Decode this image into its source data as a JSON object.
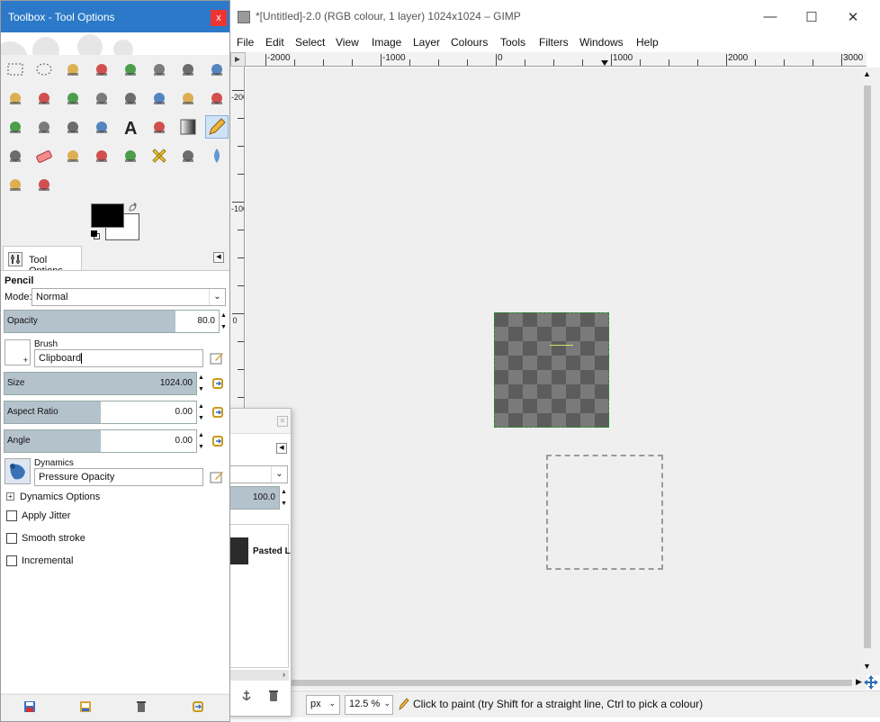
{
  "gimp": {
    "title": "*[Untitled]-2.0 (RGB colour, 1 layer) 1024x1024 – GIMP",
    "menu": [
      "File",
      "Edit",
      "Select",
      "View",
      "Image",
      "Layer",
      "Colours",
      "Tools",
      "Filters",
      "Windows",
      "Help"
    ],
    "ruler_h_labels": [
      "-2000",
      "-1000",
      "0",
      "1000",
      "2000",
      "3000"
    ],
    "ruler_v_labels": [
      "-200",
      "-100",
      "0"
    ],
    "status": {
      "coords": "…",
      "unit": "px",
      "zoom": "12.5 %",
      "message": "Click to paint (try Shift for a straight line, Ctrl to pick a colour)"
    }
  },
  "dock2": {
    "value": "100.0",
    "layer_name": "Pasted L"
  },
  "toolbox": {
    "title": "Toolbox - Tool Options",
    "close": "x",
    "tab_label": "Tool Options",
    "tool_name": "Pencil",
    "mode_label": "Mode:",
    "mode_value": "Normal",
    "opacity": {
      "label": "Opacity",
      "value": "80.0",
      "fraction": 0.8
    },
    "brush_label": "Brush",
    "brush_value": "Clipboard",
    "size": {
      "label": "Size",
      "value": "1024.00",
      "fraction": 1.0
    },
    "aspect_ratio": {
      "label": "Aspect Ratio",
      "value": "0.00",
      "fraction": 0.5
    },
    "angle": {
      "label": "Angle",
      "value": "0.00",
      "fraction": 0.5
    },
    "dynamics_label": "Dynamics",
    "dynamics_value": "Pressure Opacity",
    "dynamics_options": "Dynamics Options",
    "apply_jitter": "Apply Jitter",
    "smooth_stroke": "Smooth stroke",
    "incremental": "Incremental"
  },
  "colors": {
    "fg": "#000000",
    "bg": "#ffffff",
    "title_blue": "#2b79c8",
    "slider_fill": "#b4c2cc"
  },
  "icons": [
    "rect-select",
    "ellipse-select",
    "free-select",
    "fuzzy-select",
    "color-select",
    "scissors-select",
    "foreground-select",
    "paths",
    "color-picker",
    "zoom",
    "measure",
    "move",
    "align",
    "crop",
    "rotate",
    "scale",
    "shear",
    "perspective",
    "flip",
    "cage",
    "text",
    "bucket-fill",
    "blend",
    "pencil",
    "paintbrush",
    "eraser",
    "airbrush",
    "ink",
    "clone",
    "heal",
    "perspective-clone",
    "blur",
    "smudge",
    "dodge-burn"
  ]
}
